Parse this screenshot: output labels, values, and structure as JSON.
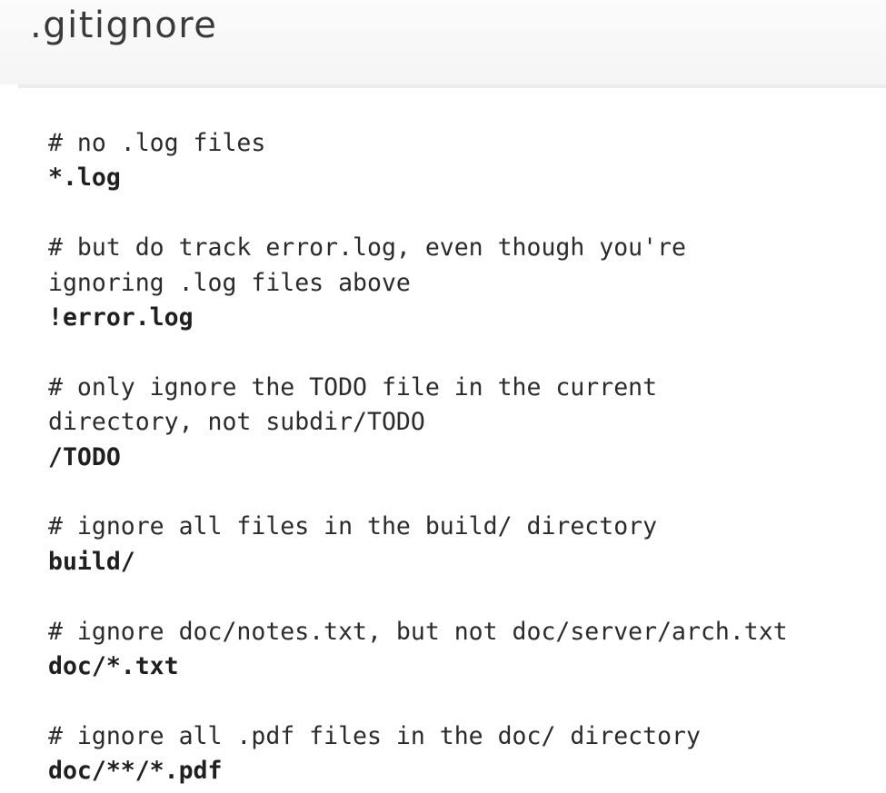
{
  "title": ".gitignore",
  "blocks": [
    {
      "comment": [
        "# no .log files"
      ],
      "pattern": "*.log"
    },
    {
      "comment": [
        "# but do track error.log, even though you're",
        "ignoring .log files above"
      ],
      "pattern": "!error.log"
    },
    {
      "comment": [
        "# only ignore the TODO file in the current",
        "directory, not subdir/TODO"
      ],
      "pattern": "/TODO"
    },
    {
      "comment": [
        "# ignore all files in the build/ directory"
      ],
      "pattern": "build/"
    },
    {
      "comment": [
        "# ignore doc/notes.txt, but not doc/server/arch.txt"
      ],
      "pattern": "doc/*.txt"
    },
    {
      "comment": [
        "# ignore all .pdf files in the doc/ directory"
      ],
      "pattern": "doc/**/*.pdf"
    }
  ]
}
